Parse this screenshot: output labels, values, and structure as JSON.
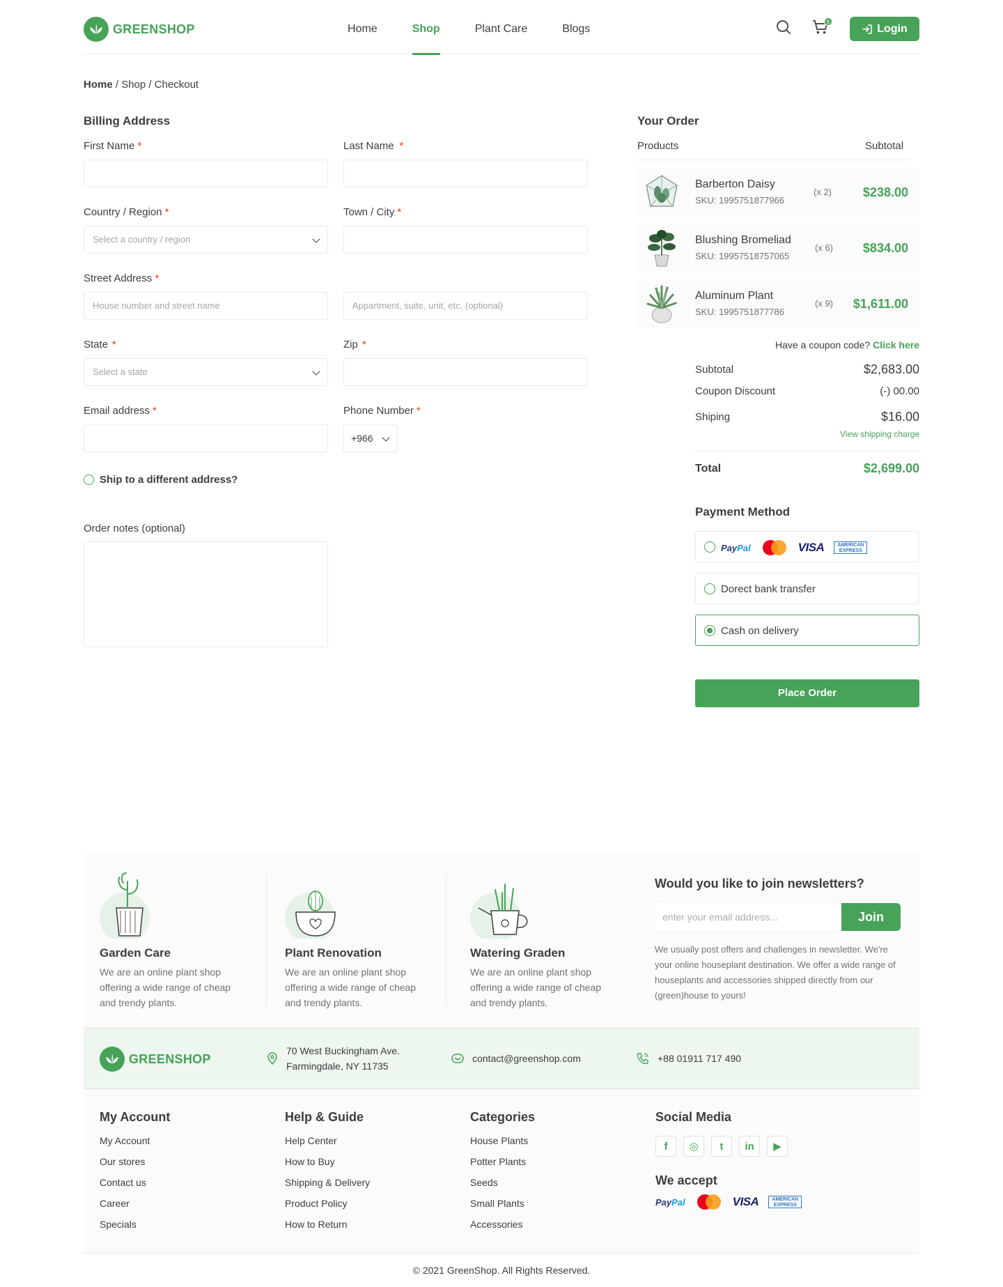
{
  "brand": {
    "name": "GREENSHOP",
    "color": "#46A358"
  },
  "nav": [
    {
      "label": "Home",
      "active": false
    },
    {
      "label": "Shop",
      "active": true
    },
    {
      "label": "Plant Care",
      "active": false
    },
    {
      "label": "Blogs",
      "active": false
    }
  ],
  "header": {
    "cart_count": "6",
    "login_label": "Login"
  },
  "breadcrumb": {
    "home": "Home",
    "rest": " / Shop / Checkout"
  },
  "billing": {
    "title": "Billing Address",
    "first_name": {
      "label": "First Name",
      "value": ""
    },
    "last_name": {
      "label": "Last Name",
      "value": ""
    },
    "country": {
      "label": "Country / Region",
      "placeholder": "Select a country / region"
    },
    "town": {
      "label": "Town / City",
      "value": ""
    },
    "street": {
      "label": "Street Address",
      "placeholder": "House number and street name",
      "placeholder2": "Appartment, suite, unit, etc. (optional)"
    },
    "state": {
      "label": "State",
      "placeholder": "Select a state"
    },
    "zip": {
      "label": "Zip",
      "value": ""
    },
    "email": {
      "label": "Email address",
      "value": ""
    },
    "phone": {
      "label": "Phone Number",
      "code": "+966"
    },
    "ship_different": "Ship to a different address?",
    "notes_label": "Order notes (optional)",
    "required_mark": "*"
  },
  "order": {
    "title": "Your Order",
    "col_products": "Products",
    "col_subtotal": "Subtotal",
    "items": [
      {
        "name": "Barberton Daisy",
        "sku": "SKU: 1995751877966",
        "qty": "(x 2)",
        "price": "$238.00"
      },
      {
        "name": "Blushing Bromeliad",
        "sku": "SKU: 19957518757065",
        "qty": "(x 6)",
        "price": "$834.00"
      },
      {
        "name": "Aluminum Plant",
        "sku": "SKU: 1995751877786",
        "qty": "(x 9)",
        "price": "$1,611.00"
      }
    ],
    "coupon_text": "Have a coupon code?",
    "coupon_link": "Click here",
    "subtotal_label": "Subtotal",
    "subtotal": "$2,683.00",
    "discount_label": "Coupon Discount",
    "discount": "(-) 00.00",
    "shipping_label": "Shiping",
    "shipping": "$16.00",
    "shipping_link": "View shipping charge",
    "total_label": "Total",
    "total": "$2,699.00",
    "payment_title": "Payment Method",
    "payment_options": [
      "Dorect bank transfer",
      "Cash on delivery"
    ],
    "place_order": "Place Order"
  },
  "paylogos": {
    "paypal_a": "Pay",
    "paypal_b": "Pal",
    "mastercard": "MasterCard",
    "visa": "VISA",
    "amex": "AMERICAN EXPRESS"
  },
  "features": [
    {
      "title": "Garden Care",
      "desc": "We are an online plant shop offering a wide range of cheap and trendy plants."
    },
    {
      "title": "Plant Renovation",
      "desc": "We are an online plant shop offering a wide range of cheap and trendy plants."
    },
    {
      "title": "Watering Graden",
      "desc": "We are an online plant shop offering a wide range of cheap and trendy plants."
    }
  ],
  "newsletter": {
    "title": "Would you like to join newsletters?",
    "placeholder": "enter your email address...",
    "button": "Join",
    "desc": "We usually post offers and challenges in newsletter. We're your online houseplant destination. We offer a wide range of houseplants and accessories shipped directly from our (green)house to yours!"
  },
  "contact": {
    "address1": "70 West Buckingham Ave.",
    "address2": "Farmingdale, NY 11735",
    "email": "contact@greenshop.com",
    "phone": "+88 01911 717 490"
  },
  "footer": {
    "my_account": {
      "title": "My Account",
      "links": [
        "My Account",
        "Our stores",
        "Contact us",
        "Career",
        "Specials"
      ]
    },
    "help": {
      "title": "Help & Guide",
      "links": [
        "Help Center",
        "How to Buy",
        "Shipping & Delivery",
        "Product Policy",
        "How to Return"
      ]
    },
    "categories": {
      "title": "Categories",
      "links": [
        "House Plants",
        "Potter Plants",
        "Seeds",
        "Small Plants",
        "Accessories"
      ]
    },
    "social_title": "Social Media",
    "social": [
      "f",
      "◎",
      "t",
      "in",
      "▶"
    ],
    "accept_title": "We accept",
    "copyright": "© 2021 GreenShop. All Rights Reserved."
  }
}
